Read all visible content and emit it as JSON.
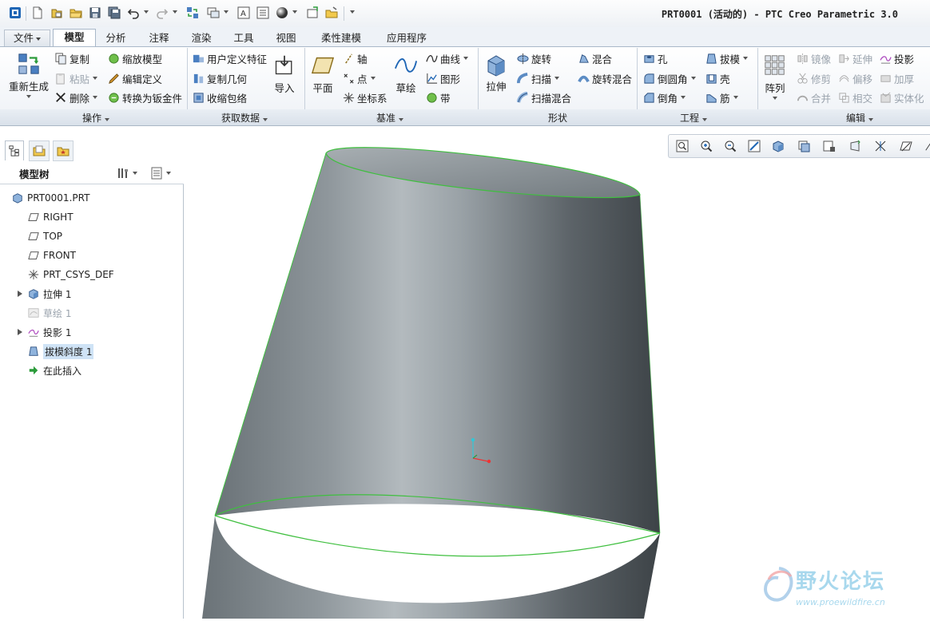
{
  "window": {
    "title": "PRT0001 (活动的) - PTC Creo Parametric 3.0"
  },
  "tabs": [
    {
      "label": "文件"
    },
    {
      "label": "模型"
    },
    {
      "label": "分析"
    },
    {
      "label": "注释"
    },
    {
      "label": "渲染"
    },
    {
      "label": "工具"
    },
    {
      "label": "视图"
    },
    {
      "label": "柔性建模"
    },
    {
      "label": "应用程序"
    }
  ],
  "ribbon": {
    "ops": {
      "regenerate": "重新生成",
      "copy": "复制",
      "paste": "粘贴",
      "delete": "删除",
      "scale_model": "缩放模型",
      "edit_def": "编辑定义",
      "to_sheetmetal": "转换为钣金件"
    },
    "get_data": {
      "udf": "用户定义特征",
      "copy_geom": "复制几何",
      "shrinkwrap": "收缩包络",
      "import": "导入"
    },
    "datum": {
      "plane": "平面",
      "axis": "轴",
      "point": "点",
      "csys": "坐标系",
      "sketch": "草绘",
      "curve": "曲线",
      "graph": "图形",
      "ribbon": "带"
    },
    "shapes": {
      "extrude": "拉伸",
      "revolve": "旋转",
      "sweep": "扫描",
      "swept_blend": "扫描混合",
      "blend": "混合",
      "rot_blend": "旋转混合"
    },
    "eng": {
      "hole": "孔",
      "round": "倒圆角",
      "chamfer": "倒角",
      "draft": "拔模",
      "shell": "壳",
      "rib": "筋"
    },
    "edit": {
      "pattern": "阵列",
      "mirror": "镜像",
      "trim": "修剪",
      "merge": "合并",
      "extend": "延伸",
      "offset": "偏移",
      "intersect": "相交",
      "project": "投影",
      "thicken": "加厚",
      "solidify": "实体化"
    },
    "groups": {
      "ops": "操作",
      "get_data": "获取数据",
      "datum": "基准",
      "shapes": "形状",
      "eng": "工程",
      "edit": "编辑"
    }
  },
  "model_tree": {
    "header": "模型树",
    "items": [
      {
        "label": "PRT0001.PRT"
      },
      {
        "label": "RIGHT"
      },
      {
        "label": "TOP"
      },
      {
        "label": "FRONT"
      },
      {
        "label": "PRT_CSYS_DEF"
      },
      {
        "label": "拉伸 1"
      },
      {
        "label": "草绘 1"
      },
      {
        "label": "投影 1"
      },
      {
        "label": "拔模斜度 1"
      },
      {
        "label": "在此插入"
      }
    ]
  },
  "watermark": {
    "name": "野火论坛",
    "url": "www.proewildfire.cn"
  },
  "colors": {
    "accent": "#1f66b5",
    "model": "#7f878d",
    "edge": "#3fbf3f",
    "selection": "#cfe3f6"
  }
}
